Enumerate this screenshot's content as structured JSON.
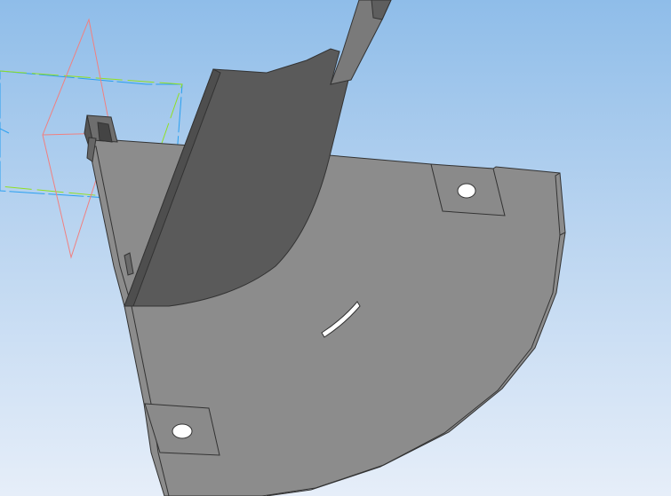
{
  "viewport": {
    "colors": {
      "background_top": "#8fbde9",
      "background_bottom": "#e6eef9",
      "plate": "#8c8c8c",
      "wall": "#5a5a5a",
      "edge": "#333333",
      "plane_red": "#f08080",
      "plane_blue": "#2aa0f0",
      "plane_green": "#90e020"
    }
  }
}
